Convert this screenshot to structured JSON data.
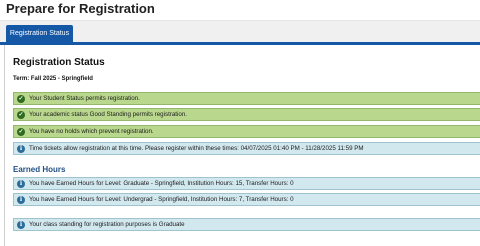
{
  "header": {
    "title": "Prepare for Registration"
  },
  "tabs": [
    {
      "label": "Registration Status",
      "active": true
    }
  ],
  "colors": {
    "tab_active": "#1558a6",
    "success_bg": "#b9d88d",
    "info_bg": "#d2e8ef"
  },
  "status_section": {
    "title": "Registration Status",
    "term": "Term: Fall 2025 - Springfield",
    "messages": [
      {
        "type": "success",
        "icon": "check-circle-icon",
        "text": "Your Student Status permits registration."
      },
      {
        "type": "success",
        "icon": "check-circle-icon",
        "text": "Your academic status Good Standing permits registration."
      },
      {
        "type": "success",
        "icon": "check-circle-icon",
        "text": "You have no holds which prevent registration."
      },
      {
        "type": "info",
        "icon": "info-circle-icon",
        "text": "Time tickets allow registration at this time. Please register within these times: 04/07/2025 01:40 PM - 11/28/2025 11:59 PM"
      }
    ]
  },
  "earned_hours": {
    "title": "Earned Hours",
    "messages": [
      {
        "type": "info",
        "icon": "info-circle-icon",
        "text": "You have Earned Hours for Level: Graduate - Springfield, Institution Hours: 15, Transfer Hours: 0"
      },
      {
        "type": "info",
        "icon": "info-circle-icon",
        "text": "You have Earned Hours for Level: Undergrad - Springfield, Institution Hours: 7, Transfer Hours: 0"
      }
    ]
  },
  "class_standing": {
    "type": "info",
    "icon": "info-circle-icon",
    "text": "Your class standing for registration purposes is Graduate"
  }
}
